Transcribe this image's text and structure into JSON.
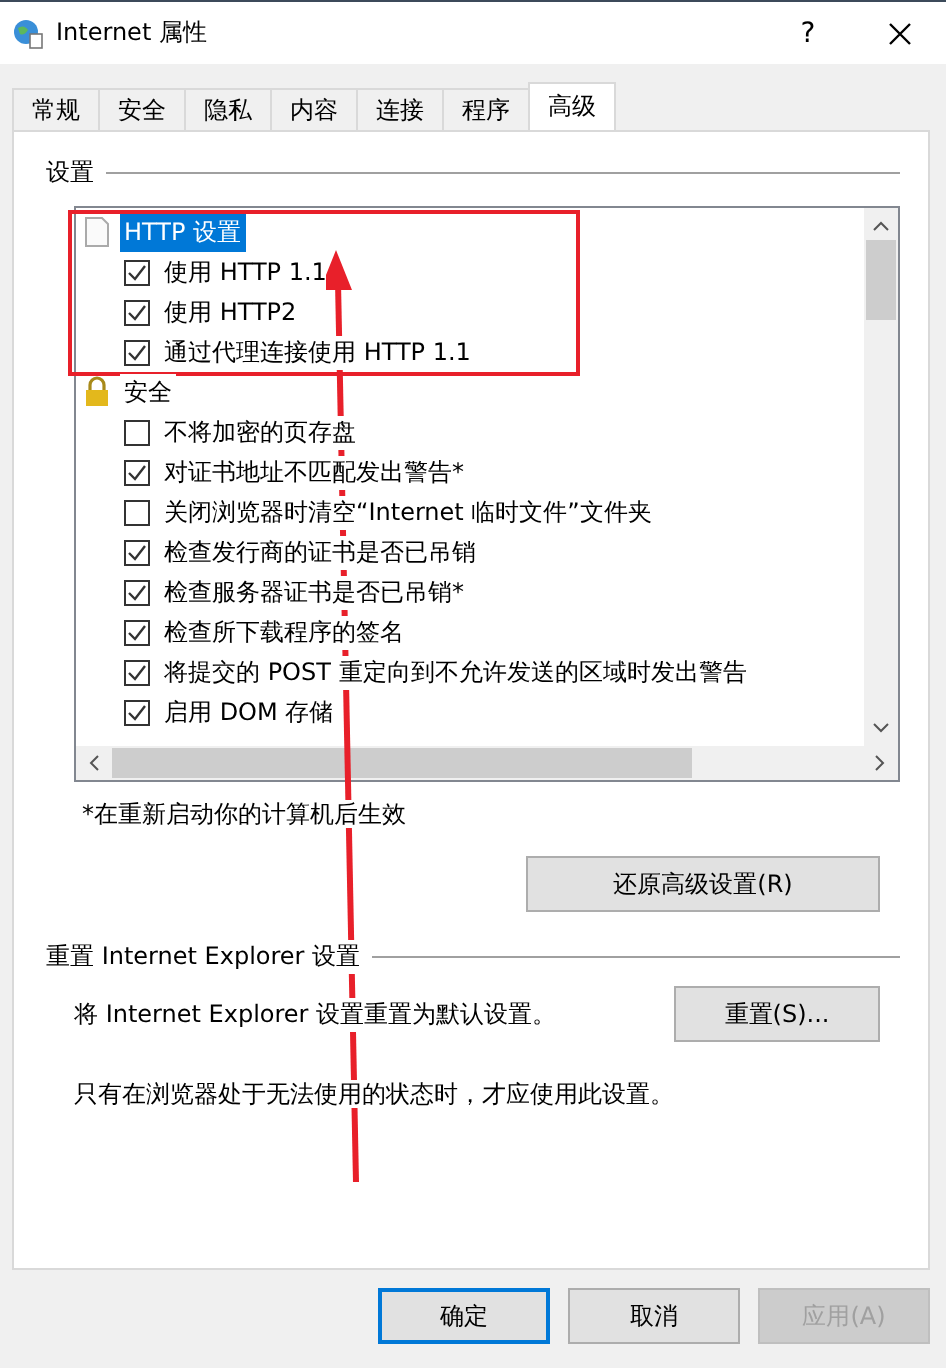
{
  "window": {
    "title": "Internet 属性",
    "help": "?"
  },
  "tabs": [
    {
      "label": "常规",
      "selected": false
    },
    {
      "label": "安全",
      "selected": false
    },
    {
      "label": "隐私",
      "selected": false
    },
    {
      "label": "内容",
      "selected": false
    },
    {
      "label": "连接",
      "selected": false
    },
    {
      "label": "程序",
      "selected": false
    },
    {
      "label": "高级",
      "selected": true
    }
  ],
  "settings": {
    "label": "设置",
    "groups": [
      {
        "label": "HTTP 设置",
        "selected": true,
        "children": [
          {
            "label": "使用 HTTP 1.1",
            "checked": true
          },
          {
            "label": "使用 HTTP2",
            "checked": true
          },
          {
            "label": "通过代理连接使用 HTTP 1.1",
            "checked": true
          }
        ]
      },
      {
        "label": "安全",
        "selected": false,
        "children": [
          {
            "label": "不将加密的页存盘",
            "checked": false
          },
          {
            "label": "对证书地址不匹配发出警告*",
            "checked": true
          },
          {
            "label": "关闭浏览器时清空“Internet 临时文件”文件夹",
            "checked": false
          },
          {
            "label": "检查发行商的证书是否已吊销",
            "checked": true
          },
          {
            "label": "检查服务器证书是否已吊销*",
            "checked": true
          },
          {
            "label": "检查所下载程序的签名",
            "checked": true
          },
          {
            "label": "将提交的 POST 重定向到不允许发送的区域时发出警告",
            "checked": true
          },
          {
            "label": "启用 DOM 存储",
            "checked": true
          }
        ]
      }
    ],
    "note": "*在重新启动你的计算机后生效",
    "restore_button": "还原高级设置(R)"
  },
  "reset": {
    "title": "重置 Internet Explorer 设置",
    "description": "将 Internet Explorer 设置重置为默认设置。",
    "button": "重置(S)...",
    "warning": "只有在浏览器处于无法使用的状态时，才应使用此设置。"
  },
  "buttons": [
    {
      "label": "确定",
      "default": true,
      "disabled": false
    },
    {
      "label": "取消",
      "default": false,
      "disabled": false
    },
    {
      "label": "应用(A)",
      "default": false,
      "disabled": true
    }
  ]
}
